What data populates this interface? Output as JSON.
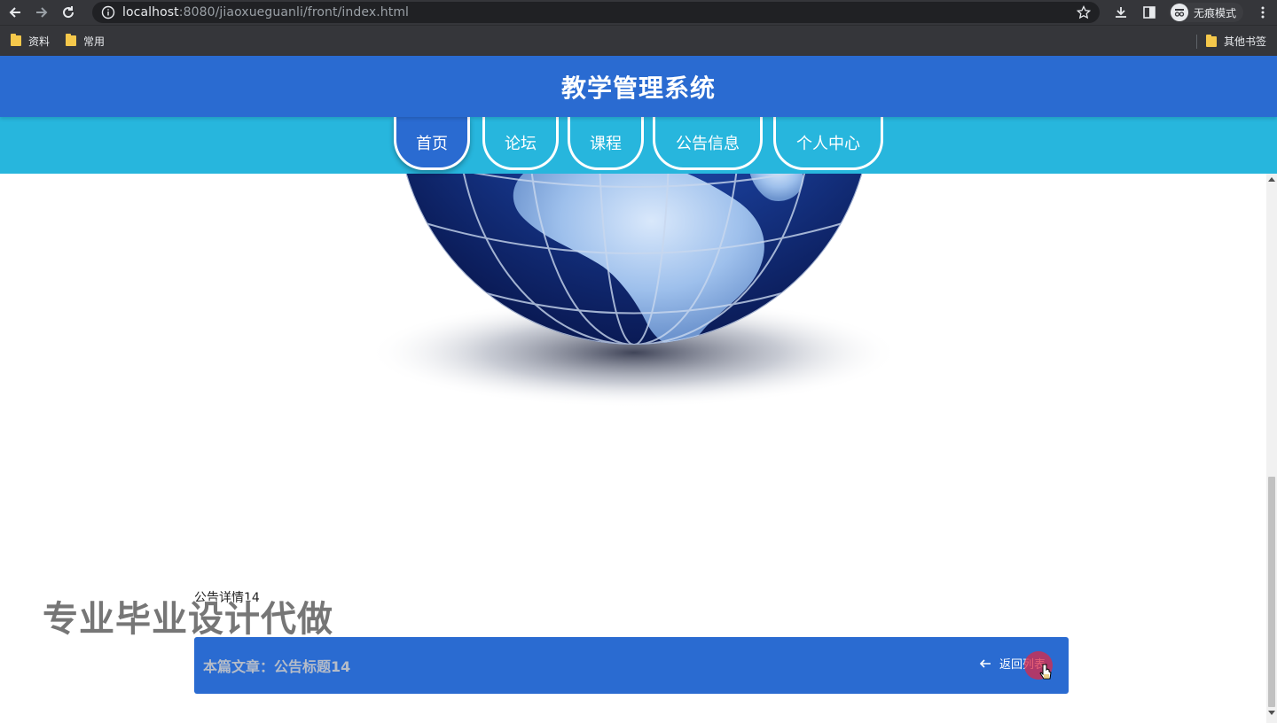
{
  "browser": {
    "url_host": "localhost",
    "url_rest": ":8080/jiaoxueguanli/front/index.html",
    "profile_label": "无痕模式",
    "bookmarks": [
      "资料",
      "常用"
    ],
    "other_bookmarks": "其他书签"
  },
  "site": {
    "title": "教学管理系统",
    "nav": [
      {
        "label": "首页",
        "active": true
      },
      {
        "label": "论坛",
        "active": false
      },
      {
        "label": "课程",
        "active": false
      },
      {
        "label": "公告信息",
        "active": false
      },
      {
        "label": "个人中心",
        "active": false
      }
    ]
  },
  "content": {
    "detail_text": "公告详情14",
    "watermark": "专业毕业设计代做",
    "article_prefix": "本篇文章：公告标题14",
    "back_label": "返回列表"
  },
  "colors": {
    "header": "#2a6bd1",
    "navbar": "#27b6dd"
  },
  "scrollbar": {
    "position_fraction": 0.6
  }
}
